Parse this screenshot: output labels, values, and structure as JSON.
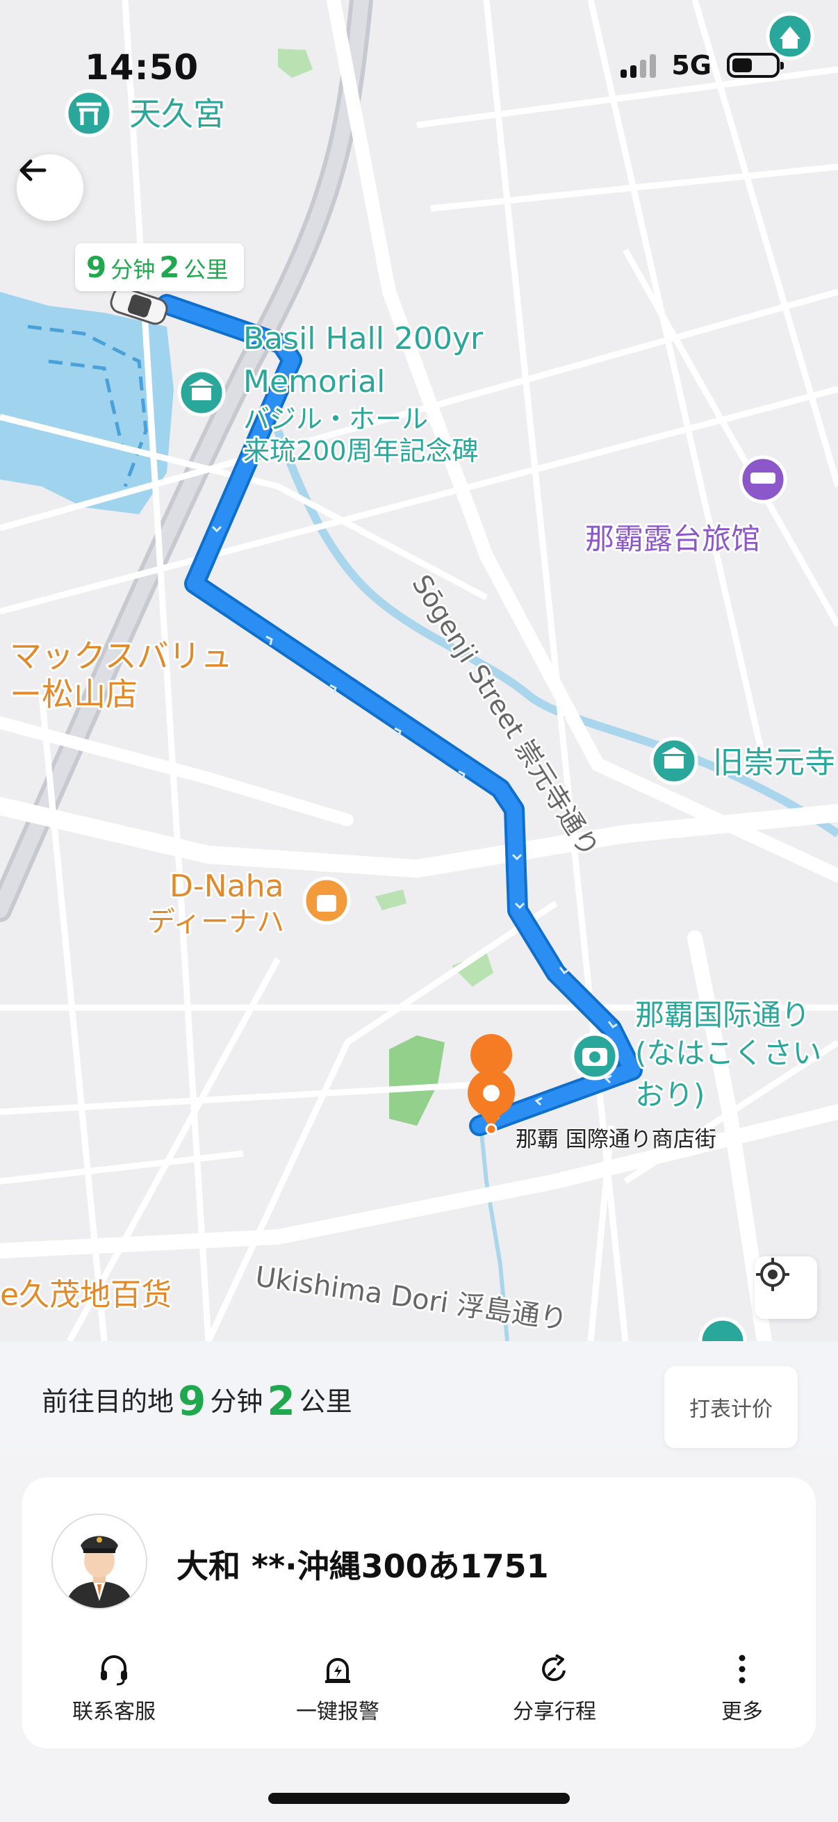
{
  "status_bar": {
    "time": "14:50",
    "network": "5G"
  },
  "map": {
    "eta_chip": {
      "minutes": "9",
      "minutes_unit": "分钟",
      "km": "2",
      "km_unit": "公里"
    },
    "destination_label": "那覇 国際通り商店街",
    "labels": {
      "tenku_shrine": "天久宮",
      "basil_hall_1": "Basil Hall 200yr",
      "basil_hall_2": "Memorial",
      "basil_hall_3": "バジル・ホール",
      "basil_hall_4": "来琉200周年記念碑",
      "hotel": "那霸露台旅馆",
      "street": "Sōgenji Street 崇元寺通り",
      "maxvalu_1": "マックスバリュ",
      "maxvalu_2": "ー松山店",
      "old_sogenji": "旧崇元寺",
      "dnaha_1": "D-Naha",
      "dnaha_2": "ディーナハ",
      "kokusai_1": "那覇国际通り",
      "kokusai_2": "(なはこくさい",
      "kokusai_3": "おり)",
      "dept_store": "e久茂地百货",
      "ukishima": "Ukishima Dori 浮島通り"
    },
    "icons": [
      "shrine-icon",
      "hotel-icon",
      "shopping-icon",
      "camera-icon",
      "locate-icon",
      "back-arrow-icon",
      "car-icon",
      "destination-pin-icon"
    ]
  },
  "summary": {
    "prefix": "前往目的地",
    "minutes": "9",
    "minutes_unit": "分钟",
    "km": "2",
    "km_unit": "公里",
    "meter_button": "打表计价"
  },
  "driver": {
    "plate": "大和 **·沖縄300あ1751"
  },
  "actions": [
    {
      "label": "联系客服",
      "icon": "headset-icon"
    },
    {
      "label": "一键报警",
      "icon": "alarm-icon"
    },
    {
      "label": "分享行程",
      "icon": "share-icon"
    },
    {
      "label": "更多",
      "icon": "more-icon"
    }
  ],
  "colors": {
    "route": "#1a8ef0",
    "accent_green": "#20a84e",
    "destination_pin": "#f57c22",
    "poi_teal": "#2aa79b",
    "poi_orange": "#e08a2c",
    "poi_purple": "#8c57c9"
  }
}
